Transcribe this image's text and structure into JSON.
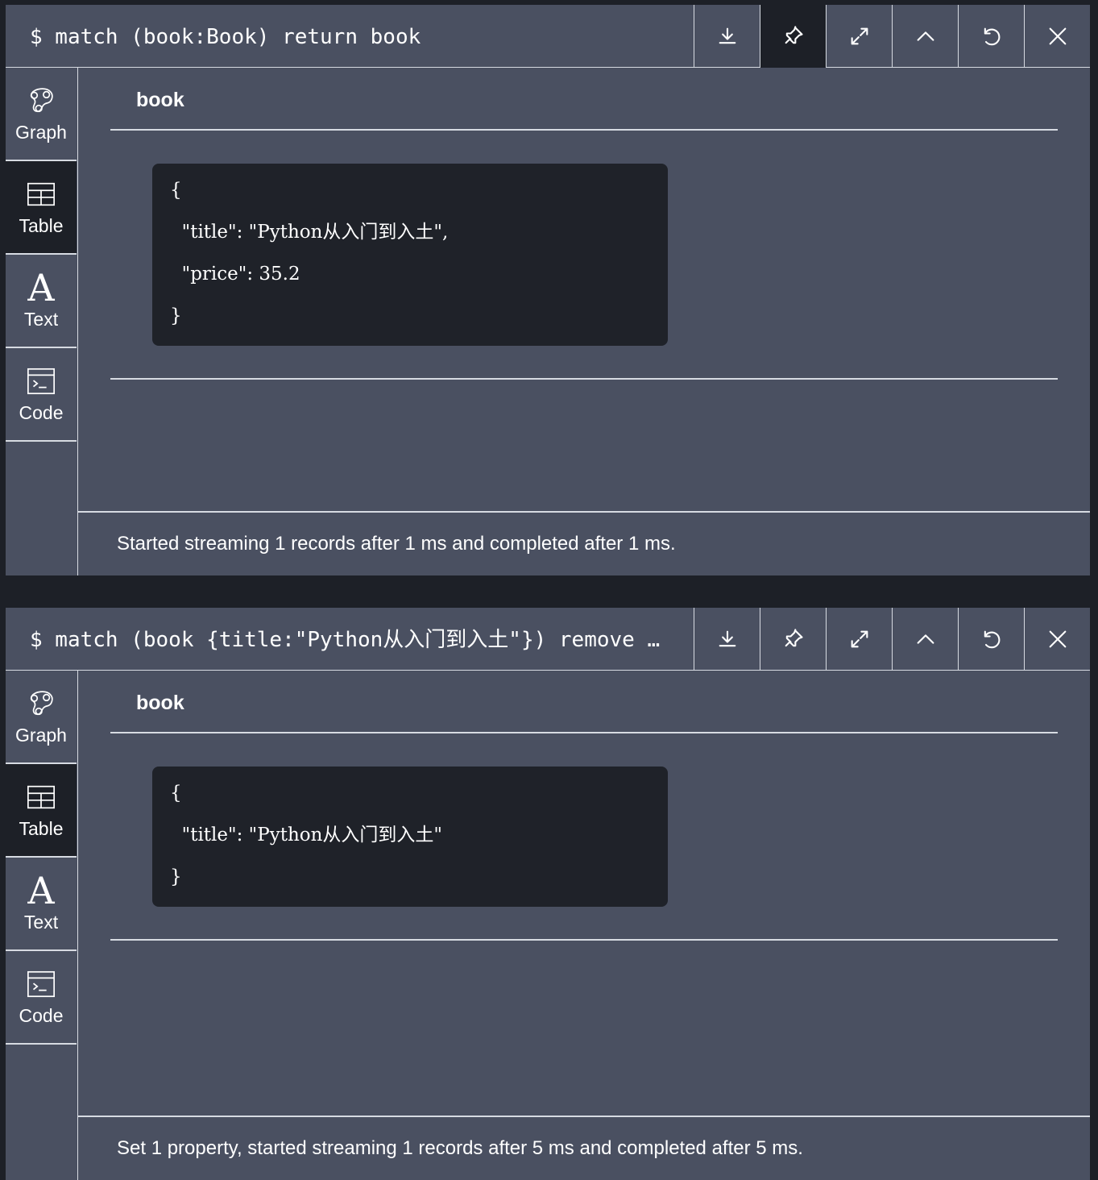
{
  "frames": [
    {
      "command": "$ match (book:Book) return book",
      "actions": [
        {
          "name": "download",
          "icon": "download-icon",
          "active": false
        },
        {
          "name": "pin",
          "icon": "pin-icon",
          "active": true
        },
        {
          "name": "fullscreen",
          "icon": "expand-icon",
          "active": false
        },
        {
          "name": "collapse",
          "icon": "chevron-up-icon",
          "active": false
        },
        {
          "name": "rerun",
          "icon": "refresh-icon",
          "active": false
        },
        {
          "name": "close",
          "icon": "close-icon",
          "active": false
        }
      ],
      "nav": [
        {
          "label": "Graph",
          "icon": "graph-icon",
          "active": false
        },
        {
          "label": "Table",
          "icon": "table-icon",
          "active": true
        },
        {
          "label": "Text",
          "icon": "text-icon",
          "active": false
        },
        {
          "label": "Code",
          "icon": "code-icon",
          "active": false
        }
      ],
      "column_header": "book",
      "json_lines": [
        "{",
        "  \"title\": \"Python从入门到入土\",",
        "  \"price\": 35.2",
        "}"
      ],
      "status": "Started streaming 1 records after 1 ms and completed after 1 ms."
    },
    {
      "command": "$ match (book {title:\"Python从入门到入土\"}) remove …",
      "actions": [
        {
          "name": "download",
          "icon": "download-icon",
          "active": false
        },
        {
          "name": "pin",
          "icon": "pin-icon",
          "active": false
        },
        {
          "name": "fullscreen",
          "icon": "expand-icon",
          "active": false
        },
        {
          "name": "collapse",
          "icon": "chevron-up-icon",
          "active": false
        },
        {
          "name": "rerun",
          "icon": "refresh-icon",
          "active": false
        },
        {
          "name": "close",
          "icon": "close-icon",
          "active": false
        }
      ],
      "nav": [
        {
          "label": "Graph",
          "icon": "graph-icon",
          "active": false
        },
        {
          "label": "Table",
          "icon": "table-icon",
          "active": true
        },
        {
          "label": "Text",
          "icon": "text-icon",
          "active": false
        },
        {
          "label": "Code",
          "icon": "code-icon",
          "active": false
        }
      ],
      "column_header": "book",
      "json_lines": [
        "{",
        "  \"title\": \"Python从入门到入土\"",
        "}"
      ],
      "status": "Set 1 property, started streaming 1 records after 5 ms and completed after 5 ms."
    }
  ]
}
